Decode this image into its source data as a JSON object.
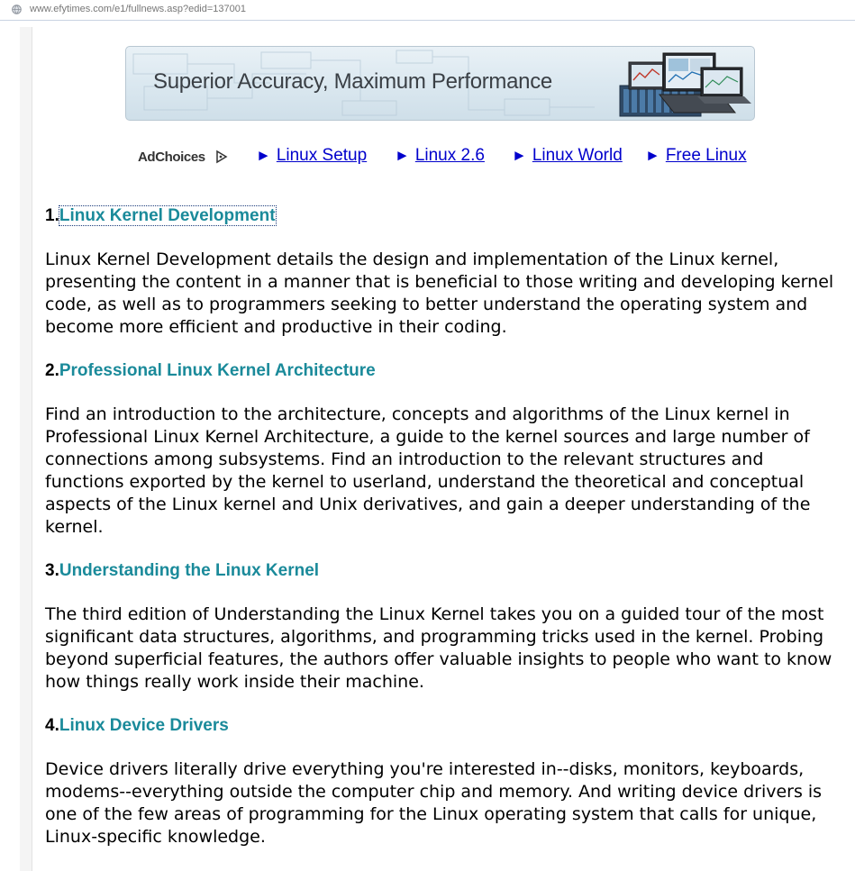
{
  "browser": {
    "url": "www.efytimes.com/e1/fullnews.asp?edid=137001"
  },
  "ad_banner": {
    "text": "Superior Accuracy, Maximum Performance"
  },
  "ad_nav": {
    "adchoices_label": "AdChoices",
    "links": [
      {
        "label": "Linux Setup"
      },
      {
        "label": "Linux 2.6"
      },
      {
        "label": "Linux World"
      },
      {
        "label": "Free Linux"
      }
    ]
  },
  "items": [
    {
      "number": "1.",
      "title": "Linux Kernel Development",
      "description": "Linux Kernel Development details the design and implementation of the Linux kernel, presenting the content in a manner that is beneficial to those writing and developing kernel code, as well as to programmers seeking to better understand the operating system and become more efficient and productive in their coding."
    },
    {
      "number": "2.",
      "title": "Professional Linux Kernel Architecture",
      "description": "Find an introduction to the architecture, concepts and algorithms of the Linux kernel in Professional Linux Kernel Architecture, a guide to the kernel sources and large number of connections among subsystems. Find an introduction to the relevant structures and functions exported by the kernel to userland, understand the theoretical and conceptual aspects of the Linux kernel and Unix derivatives, and gain a deeper understanding of the kernel."
    },
    {
      "number": "3.",
      "title": "Understanding the Linux Kernel",
      "description": "The third edition of Understanding the Linux Kernel takes you on a guided tour of the most significant data structures, algorithms, and programming tricks used in the kernel. Probing beyond superficial features, the authors offer valuable insights to people who want to know how things really work inside their machine."
    },
    {
      "number": "4.",
      "title": "Linux Device Drivers",
      "description": "Device drivers literally drive everything you're interested in--disks, monitors, keyboards, modems--everything outside the computer chip and memory. And writing device drivers is one of the few areas of programming for the Linux operating system that calls for unique, Linux-specific knowledge."
    }
  ],
  "colors": {
    "heading_link": "#1a8a9a",
    "ad_link": "#0000cc"
  }
}
